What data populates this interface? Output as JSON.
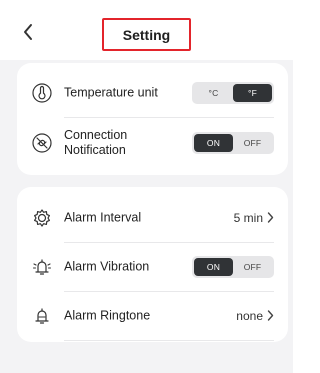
{
  "header": {
    "title": "Setting",
    "back_icon": "chevron-left-icon"
  },
  "card1": {
    "temperature": {
      "label": "Temperature unit",
      "icon": "thermometer-icon",
      "options": [
        "°C",
        "°F"
      ],
      "selected": "°F"
    },
    "connection": {
      "label": "Connection Notification",
      "icon": "link-off-icon",
      "options": [
        "ON",
        "OFF"
      ],
      "selected": "ON"
    }
  },
  "card2": {
    "interval": {
      "label": "Alarm Interval",
      "icon": "gear-icon",
      "value": "5 min"
    },
    "vibration": {
      "label": "Alarm Vibration",
      "icon": "vibrating-bell-icon",
      "options": [
        "ON",
        "OFF"
      ],
      "selected": "ON"
    },
    "ringtone": {
      "label": "Alarm Ringtone",
      "icon": "bell-icon",
      "value": "none"
    }
  }
}
